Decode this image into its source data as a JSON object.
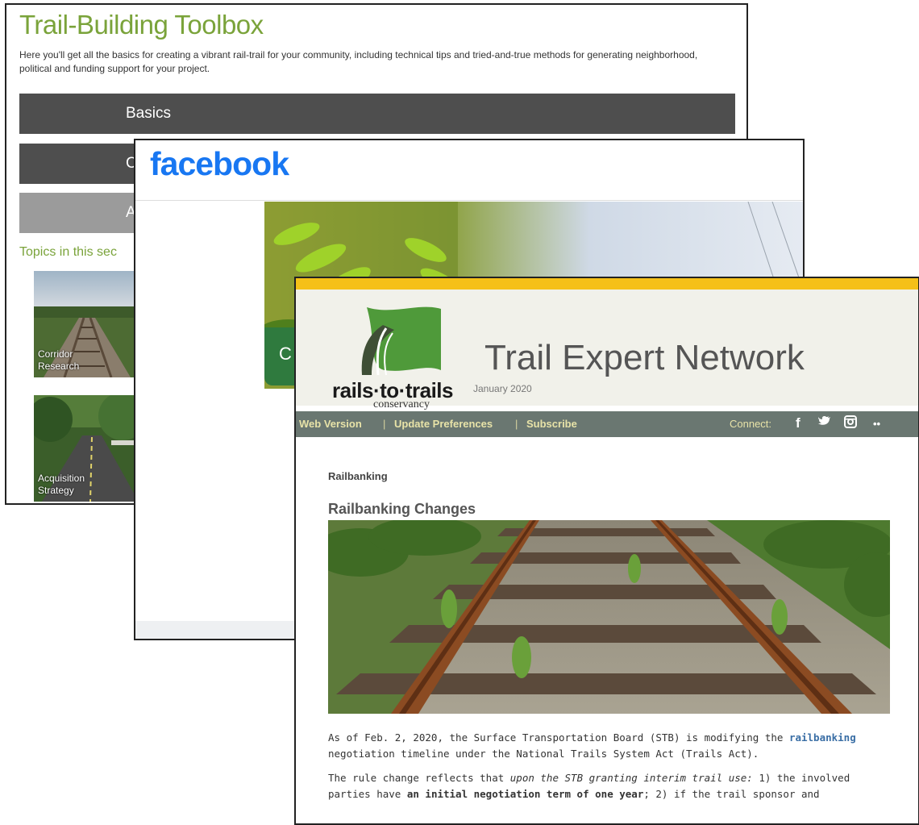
{
  "toolbox": {
    "title": "Trail-Building Toolbox",
    "description": "Here you'll get all the basics for creating a vibrant rail-trail for your community, including technical tips and tried-and-true methods for generating neighborhood, political and funding support for your project.",
    "bars": [
      {
        "label": "Basics"
      },
      {
        "label": "C"
      },
      {
        "label": "A"
      }
    ],
    "topics_heading": "Topics in this sec",
    "thumbnails": [
      {
        "label": "Corridor Research"
      },
      {
        "label": "Acquisition Strategy"
      }
    ]
  },
  "facebook": {
    "logo": "facebook",
    "cover_button_letter": "C"
  },
  "newsletter": {
    "brand": {
      "wordmark": "rails·to·trails",
      "subtitle": "conservancy"
    },
    "title": "Trail Expert Network",
    "date": "January 2020",
    "nav": {
      "web_version": "Web Version",
      "separator": "|",
      "update_preferences": "Update Preferences",
      "subscribe": "Subscribe",
      "connect": "Connect:",
      "social": [
        {
          "icon": "facebook-icon",
          "glyph": "f"
        },
        {
          "icon": "twitter-icon",
          "glyph": "🐦"
        },
        {
          "icon": "instagram-icon",
          "glyph": "◙"
        },
        {
          "icon": "flickr-icon",
          "glyph": "••"
        }
      ]
    },
    "section_label": "Railbanking",
    "headline": "Railbanking Changes",
    "para1": {
      "before": "As of Feb. 2, 2020, the Surface Transportation Board (STB) is modifying the ",
      "link": "railbanking",
      "after": " negotiation timeline under the National Trails System Act (Trails Act)."
    },
    "para2": {
      "a": "The rule change reflects that ",
      "b_italic": "upon the STB granting interim trail use:",
      "c": " 1) the involved parties have ",
      "d_bold": "an initial negotiation term of one year",
      "e": "; 2) if the trail sponsor and"
    }
  }
}
